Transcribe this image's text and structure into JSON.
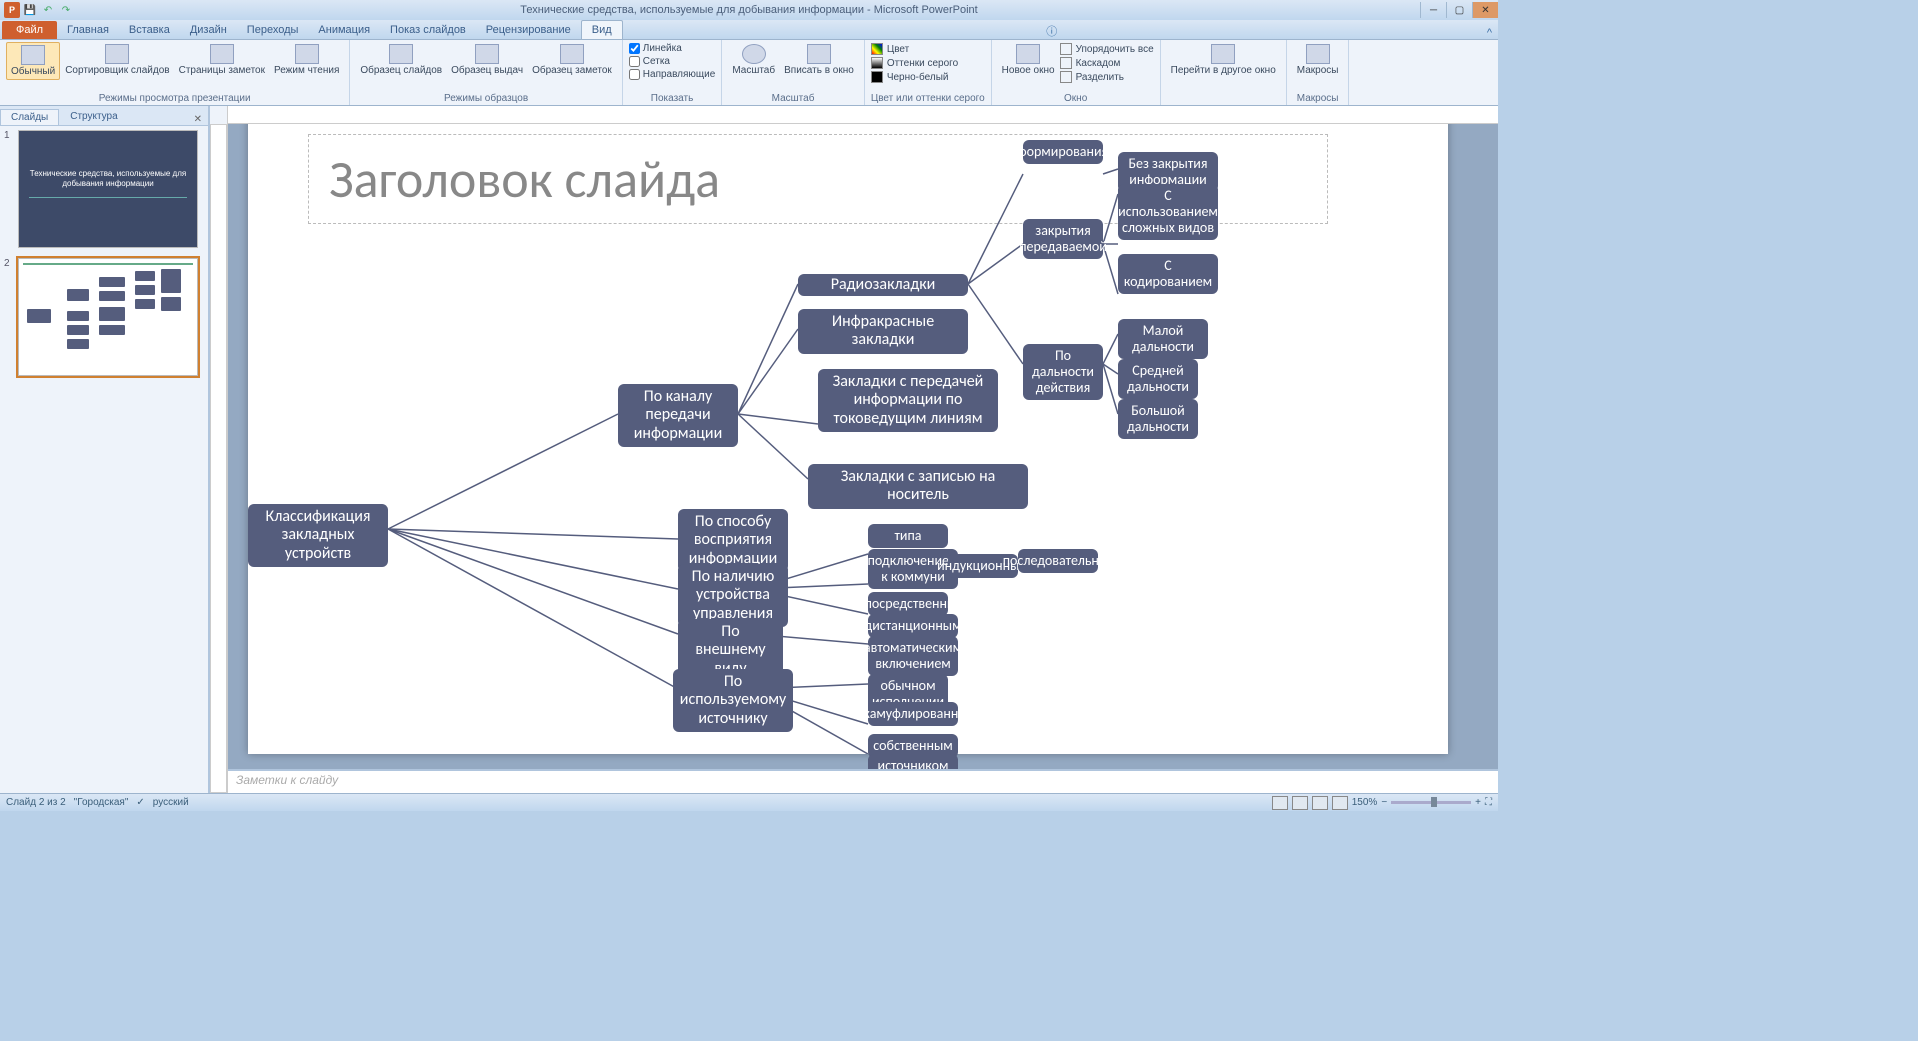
{
  "app": {
    "title": "Технические средства, используемые для добывания информации - Microsoft PowerPoint"
  },
  "tabs": {
    "file": "Файл",
    "home": "Главная",
    "insert": "Вставка",
    "design": "Дизайн",
    "transitions": "Переходы",
    "animations": "Анимация",
    "slideshow": "Показ слайдов",
    "review": "Рецензирование",
    "view": "Вид"
  },
  "ribbon": {
    "g1": {
      "normal": "Обычный",
      "sorter": "Сортировщик слайдов",
      "notes": "Страницы заметок",
      "reading": "Режим чтения",
      "label": "Режимы просмотра презентации"
    },
    "g2": {
      "slide_master": "Образец слайдов",
      "handout_master": "Образец выдач",
      "notes_master": "Образец заметок",
      "label": "Режимы образцов"
    },
    "g3": {
      "ruler": "Линейка",
      "grid": "Сетка",
      "guides": "Направляющие",
      "label": "Показать"
    },
    "g4": {
      "zoom": "Масштаб",
      "fit": "Вписать в окно",
      "label": "Масштаб"
    },
    "g5": {
      "color": "Цвет",
      "gray": "Оттенки серого",
      "bw": "Черно-белый",
      "label": "Цвет или оттенки серого"
    },
    "g6": {
      "new_window": "Новое окно",
      "arrange": "Упорядочить все",
      "cascade": "Каскадом",
      "split": "Разделить",
      "label": "Окно"
    },
    "g7": {
      "switch": "Перейти в другое окно",
      "label": ""
    },
    "g8": {
      "macros": "Макросы",
      "label": "Макросы"
    }
  },
  "panel": {
    "slides_tab": "Слайды",
    "outline_tab": "Структура",
    "slide1_title": "Технические средства, используемые для добывания информации"
  },
  "slide": {
    "title": "Заголовок слайда",
    "n_root": "Классификация закладных устройств",
    "n_channel": "По каналу передачи информации",
    "n_radio": "Радиозакладки",
    "n_ir": "Инфракрасные закладки",
    "n_lines": "Закладки с передачей информации по токоведущим линиям",
    "n_record": "Закладки с записью на носитель",
    "n_form": "формирования",
    "n_close": "закрытия передаваемой",
    "n_range": "По дальности действия",
    "n_nocover": "Без закрытия информации",
    "n_complex": "С использованием сложных видов",
    "n_coding": "С кодированием",
    "n_small": "Малой дальности",
    "n_medium": "Средней дальности",
    "n_large": "Большой дальности",
    "n_perception": "По способу восприятия информации",
    "n_control": "По наличию устройства управления",
    "n_appearance": "По внешнему виду",
    "n_source": "По используемому источнику",
    "n_conn": "подключением к коммуни",
    "n_type": "типа",
    "n_remote": "дистанционным",
    "n_auto": "автоматическим включением",
    "n_usual": "обычном исполнении",
    "n_camo": "закамуфлированном",
    "n_power": "источником",
    "n_induct": "индукционным",
    "n_own": "собственным",
    "n_seq": "последовательное",
    "n_direct": "непосредственным"
  },
  "notes": "Заметки к слайду",
  "status": {
    "slide_info": "Слайд 2 из 2",
    "theme": "\"Городская\"",
    "lang": "русский",
    "zoom": "150%"
  }
}
